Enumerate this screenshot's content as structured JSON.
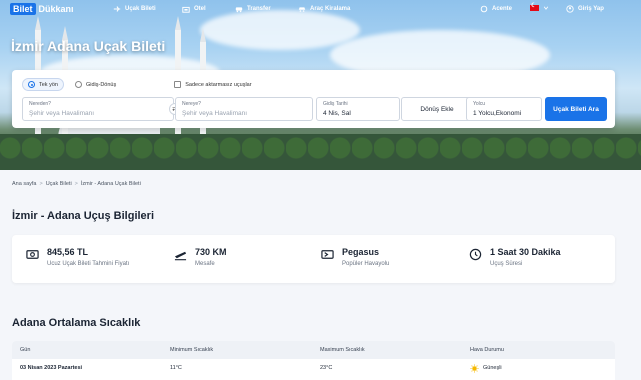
{
  "nav": {
    "logo_main": "Bilet",
    "logo_rest": "Dükkanı",
    "items": [
      {
        "label": "Uçak Bileti",
        "icon": "plane-icon"
      },
      {
        "label": "Otel",
        "icon": "hotel-icon"
      },
      {
        "label": "Transfer",
        "icon": "transfer-icon"
      },
      {
        "label": "Araç Kiralama",
        "icon": "car-icon"
      }
    ],
    "agency": "Acente",
    "language_flag": "tr-flag-icon",
    "login": "Giriş Yap"
  },
  "hero": {
    "title": "İzmir Adana Uçak Bileti"
  },
  "search": {
    "trip_one_way": "Tek yön",
    "trip_round": "Gidiş-Dönüş",
    "direct_only": "Sadece aktarmasız uçuşlar",
    "from_label": "Nereden?",
    "from_placeholder": "Şehir veya Havalimanı",
    "to_label": "Nereye?",
    "to_placeholder": "Şehir veya Havalimanı",
    "date_label": "Gidiş Tarihi",
    "date_value": "4 Nis, Sal",
    "return_label": "Dönüş Ekle",
    "pax_label": "Yolcu",
    "pax_value": "1 Yolcu,Ekonomi",
    "submit": "Uçak Bileti Ara"
  },
  "breadcrumb": [
    "Ana sayfa",
    "Uçak Bileti",
    "İzmir - Adana Uçak Bileti"
  ],
  "info": {
    "title": "İzmir - Adana Uçuş Bilgileri",
    "stats": [
      {
        "value": "845,56 TL",
        "label": "Ucuz Uçak Bileti Tahmini Fiyatı",
        "icon": "money-icon"
      },
      {
        "value": "730 KM",
        "label": "Mesafe",
        "icon": "plane-takeoff-icon"
      },
      {
        "value": "Pegasus",
        "label": "Popüler Havayolu",
        "icon": "ticket-icon"
      },
      {
        "value": "1 Saat 30 Dakika",
        "label": "Uçuş Süresi",
        "icon": "clock-icon"
      }
    ]
  },
  "temps": {
    "title": "Adana Ortalama Sıcaklık",
    "headers": [
      "Gün",
      "Minimum Sıcaklık",
      "Maximum Sıcaklık",
      "Hava Durumu"
    ],
    "rows": [
      {
        "day": "03 Nisan 2023 Pazartesi",
        "min": "11°C",
        "max": "23°C",
        "weather": "Güneşli"
      }
    ]
  },
  "colors": {
    "primary": "#1a73e8",
    "sun": "#f5b800"
  }
}
